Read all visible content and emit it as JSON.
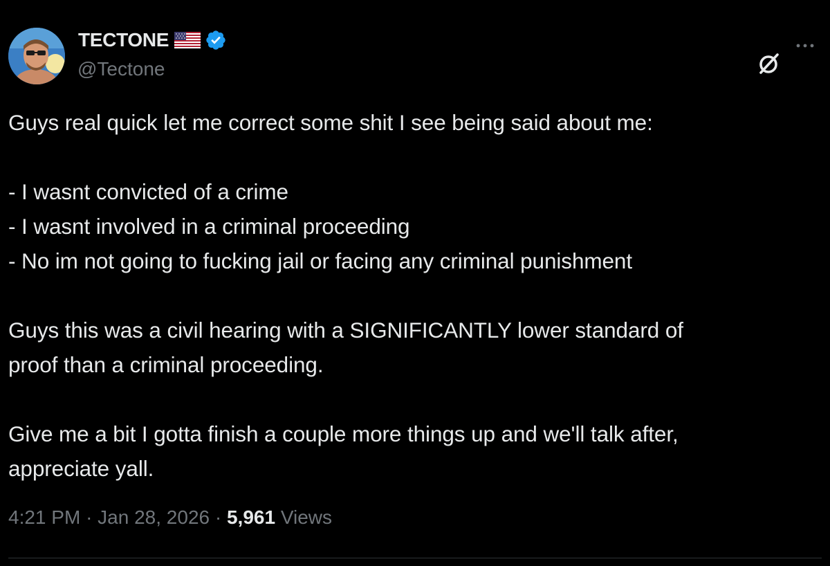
{
  "author": {
    "display_name": "TECTONE",
    "handle": "@Tectone",
    "verified_color": "#1d9bf0"
  },
  "post": {
    "lines": [
      "Guys real quick let me correct some shit I see being said about me:",
      "",
      "- I wasnt convicted of a crime",
      "- I wasnt involved in a criminal proceeding",
      "- No im not going to fucking jail or facing any criminal punishment",
      "",
      "Guys this was a civil hearing with a SIGNIFICANTLY lower standard of",
      "proof than a criminal proceeding.",
      "",
      "Give me a bit I gotta finish a couple more things up and we'll talk after,",
      "appreciate yall."
    ]
  },
  "meta": {
    "time": "4:21 PM",
    "separator": "·",
    "date": "Jan 28, 2026",
    "views_count": "5,961",
    "views_label": "Views"
  },
  "icons": {
    "avatar": "avatar-image",
    "flag": "us-flag-icon",
    "verified": "verified-badge-icon",
    "grok": "grok-icon",
    "more": "more-icon"
  },
  "colors": {
    "background": "#000000",
    "text": "#e7e9ea",
    "secondary": "#71767b",
    "accent": "#1d9bf0"
  }
}
